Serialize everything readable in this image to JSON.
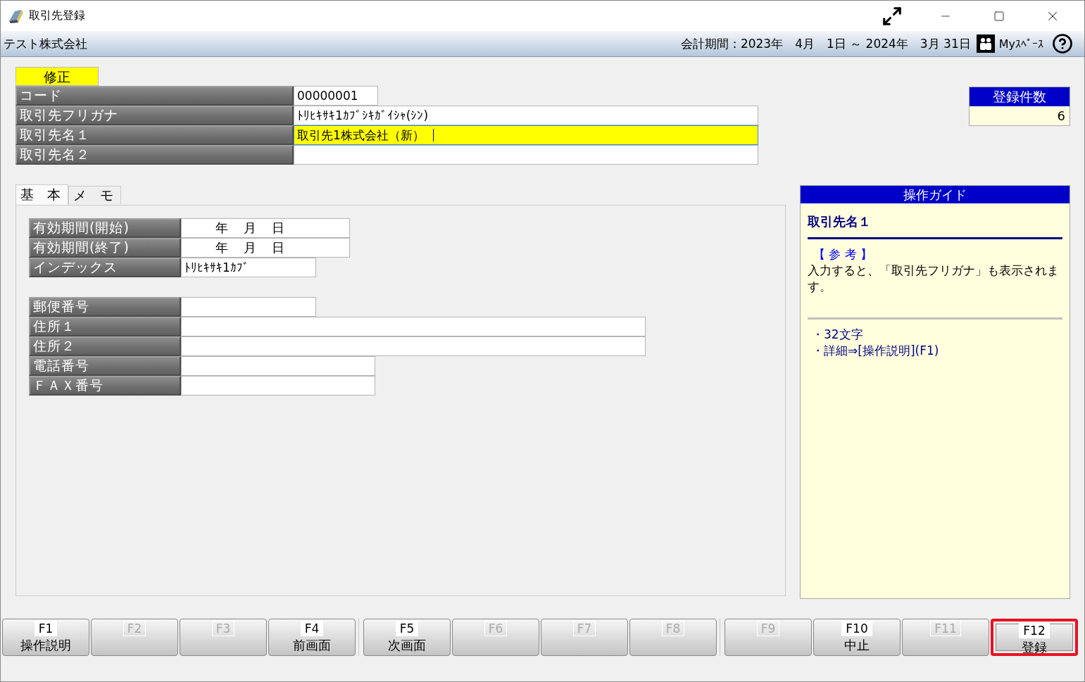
{
  "window": {
    "title": "取引先登録"
  },
  "header": {
    "company": "テスト株式会社",
    "period": "会計期間：2023年　4月　1日 ～ 2024年　3月 31日",
    "myspace": "Myｽﾍﾟｰｽ"
  },
  "mode_badge": "修正",
  "top_fields": [
    {
      "label": "コード",
      "value": "00000001",
      "focused": false
    },
    {
      "label": "取引先フリガナ",
      "value": "ﾄﾘﾋｷｻｷ1ｶﾌﾞｼｷｶﾞｲｼｬ(ｼﾝ)",
      "focused": false
    },
    {
      "label": "取引先名１",
      "value": "取引先1株式会社（新）",
      "focused": true
    },
    {
      "label": "取引先名２",
      "focused": false
    }
  ],
  "count_panel": {
    "title": "登録件数",
    "value": "6"
  },
  "tabs": [
    {
      "label": "基　本",
      "selected": true
    },
    {
      "label": "メ　モ",
      "selected": false
    }
  ],
  "form_groups": [
    [
      {
        "label": "有効期間(開始)",
        "kind": "date",
        "parts": [
          "年",
          "月",
          "日"
        ]
      },
      {
        "label": "有効期間(終了)",
        "kind": "date",
        "parts": [
          "年",
          "月",
          "日"
        ]
      },
      {
        "label": "インデックス",
        "kind": "text",
        "value": "ﾄﾘﾋｷｻｷ1ｶﾌﾞ"
      }
    ],
    [
      {
        "label": "郵便番号",
        "kind": "text"
      },
      {
        "label": "住所１",
        "kind": "text"
      },
      {
        "label": "住所２",
        "kind": "text"
      },
      {
        "label": "電話番号",
        "kind": "text"
      },
      {
        "label": "ＦＡＸ番号",
        "kind": "text"
      }
    ]
  ],
  "guide": {
    "title": "操作ガイド",
    "heading": "取引先名１",
    "reference_label": "【 参 考 】",
    "text": "入力すると、「取引先フリガナ」も表示されます。",
    "notes": [
      "・32文字",
      "・詳細⇒[操作説明](F1)"
    ]
  },
  "function_keys": [
    {
      "key": "F1",
      "label": "操作説明",
      "disabled": false,
      "highlighted": false
    },
    {
      "key": "F2",
      "disabled": true,
      "highlighted": false
    },
    {
      "key": "F3",
      "disabled": true,
      "highlighted": false
    },
    {
      "key": "F4",
      "label": "前画面",
      "disabled": false,
      "highlighted": false
    },
    {
      "key": "F5",
      "label": "次画面",
      "disabled": false,
      "highlighted": false
    },
    {
      "key": "F6",
      "disabled": true,
      "highlighted": false
    },
    {
      "key": "F7",
      "disabled": true,
      "highlighted": false
    },
    {
      "key": "F8",
      "disabled": true,
      "highlighted": false
    },
    {
      "key": "F9",
      "disabled": true,
      "highlighted": false
    },
    {
      "key": "F10",
      "label": "中止",
      "disabled": false,
      "highlighted": false
    },
    {
      "key": "F11",
      "disabled": true,
      "highlighted": false
    },
    {
      "key": "F12",
      "label": "登録",
      "disabled": false,
      "highlighted": true
    }
  ]
}
